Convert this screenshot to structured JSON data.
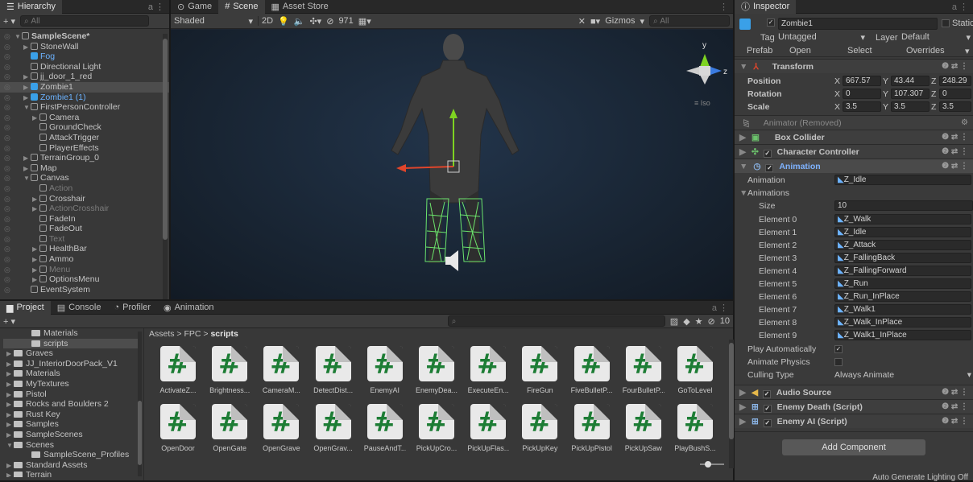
{
  "hierarchy": {
    "tab": "Hierarchy",
    "add": "+ ▾",
    "search_placeholder": "All",
    "items": [
      {
        "label": "SampleScene*",
        "indent": 0,
        "bold": true,
        "arrow": "▼",
        "cls": "scene"
      },
      {
        "label": "StoneWall",
        "indent": 1,
        "arrow": "▶"
      },
      {
        "label": "Fog",
        "indent": 1,
        "arrow": "",
        "cls": "blue",
        "cube": "blue"
      },
      {
        "label": "Directional Light",
        "indent": 1,
        "arrow": ""
      },
      {
        "label": "jj_door_1_red",
        "indent": 1,
        "arrow": "▶"
      },
      {
        "label": "Zombie1",
        "indent": 1,
        "arrow": "▶",
        "cls": "sel",
        "cube": "blue"
      },
      {
        "label": "Zombie1 (1)",
        "indent": 1,
        "arrow": "▶",
        "cls": "blue",
        "cube": "blue"
      },
      {
        "label": "FirstPersonController",
        "indent": 1,
        "arrow": "▼"
      },
      {
        "label": "Camera",
        "indent": 2,
        "arrow": "▶"
      },
      {
        "label": "GroundCheck",
        "indent": 2,
        "arrow": ""
      },
      {
        "label": "AttackTrigger",
        "indent": 2,
        "arrow": ""
      },
      {
        "label": "PlayerEffects",
        "indent": 2,
        "arrow": ""
      },
      {
        "label": "TerrainGroup_0",
        "indent": 1,
        "arrow": "▶"
      },
      {
        "label": "Map",
        "indent": 1,
        "arrow": "▶"
      },
      {
        "label": "Canvas",
        "indent": 1,
        "arrow": "▼"
      },
      {
        "label": "Action",
        "indent": 2,
        "arrow": "",
        "cls": "dim"
      },
      {
        "label": "Crosshair",
        "indent": 2,
        "arrow": "▶"
      },
      {
        "label": "ActionCrosshair",
        "indent": 2,
        "arrow": "▶",
        "cls": "dim"
      },
      {
        "label": "FadeIn",
        "indent": 2,
        "arrow": ""
      },
      {
        "label": "FadeOut",
        "indent": 2,
        "arrow": ""
      },
      {
        "label": "Text",
        "indent": 2,
        "arrow": "",
        "cls": "dim"
      },
      {
        "label": "HealthBar",
        "indent": 2,
        "arrow": "▶"
      },
      {
        "label": "Ammo",
        "indent": 2,
        "arrow": "▶"
      },
      {
        "label": "Menu",
        "indent": 2,
        "arrow": "▶",
        "cls": "dim"
      },
      {
        "label": "OptionsMenu",
        "indent": 2,
        "arrow": "▶"
      },
      {
        "label": "EventSystem",
        "indent": 1,
        "arrow": ""
      }
    ]
  },
  "scene": {
    "tabs": [
      "Game",
      "Scene",
      "Asset Store"
    ],
    "shading": "Shaded",
    "mode2d": "2D",
    "hidden_count": "971",
    "gizmos": "Gizmos",
    "search_placeholder": "All",
    "iso": "≡ Iso",
    "axis_y": "y",
    "axis_z": "z"
  },
  "bottom": {
    "tabs": [
      "Project",
      "Console",
      "Profiler",
      "Animation"
    ],
    "hidden_count": "10",
    "breadcrumb": [
      "Assets",
      "FPC",
      "scripts"
    ],
    "folders": [
      {
        "label": "Materials",
        "indent": 2
      },
      {
        "label": "scripts",
        "indent": 2,
        "sel": true
      },
      {
        "label": "Graves",
        "indent": 0,
        "arrow": "▶"
      },
      {
        "label": "JJ_InteriorDoorPack_V1",
        "indent": 0,
        "arrow": "▶"
      },
      {
        "label": "Materials",
        "indent": 0,
        "arrow": "▶"
      },
      {
        "label": "MyTextures",
        "indent": 0,
        "arrow": "▶"
      },
      {
        "label": "Pistol",
        "indent": 0,
        "arrow": "▶"
      },
      {
        "label": "Rocks and Boulders 2",
        "indent": 0,
        "arrow": "▶"
      },
      {
        "label": "Rust Key",
        "indent": 0,
        "arrow": "▶"
      },
      {
        "label": "Samples",
        "indent": 0,
        "arrow": "▶"
      },
      {
        "label": "SampleScenes",
        "indent": 0,
        "arrow": "▶"
      },
      {
        "label": "Scenes",
        "indent": 0,
        "arrow": "▼"
      },
      {
        "label": "SampleScene_Profiles",
        "indent": 2
      },
      {
        "label": "Standard Assets",
        "indent": 0,
        "arrow": "▶"
      },
      {
        "label": "Terrain",
        "indent": 0,
        "arrow": "▶"
      }
    ],
    "assets_row1": [
      "ActivateZ...",
      "Brightness...",
      "CameraM...",
      "DetectDist...",
      "EnemyAI",
      "EnemyDea...",
      "ExecuteEn...",
      "FireGun",
      "FiveBulletP...",
      "FourBulletP...",
      "GoToLevel"
    ],
    "assets_row2": [
      "OpenDoor",
      "OpenGate",
      "OpenGrave",
      "OpenGrav...",
      "PauseAndT...",
      "PickUpCro...",
      "PickUpFlas...",
      "PickUpKey",
      "PickUpPistol",
      "PickUpSaw",
      "PlayBushS..."
    ],
    "glyph": "#"
  },
  "inspector": {
    "tab": "Inspector",
    "name": "Zombie1",
    "static": "Static",
    "tag_label": "Tag",
    "tag": "Untagged",
    "layer_label": "Layer",
    "layer": "Default",
    "prefab_label": "Prefab",
    "prefab_open": "Open",
    "prefab_select": "Select",
    "prefab_overrides": "Overrides",
    "transform": {
      "title": "Transform",
      "rows": [
        {
          "label": "Position",
          "x": "667.57",
          "y": "43.44",
          "z": "248.29"
        },
        {
          "label": "Rotation",
          "x": "0",
          "y": "107.307",
          "z": "0"
        },
        {
          "label": "Scale",
          "x": "3.5",
          "y": "3.5",
          "z": "3.5"
        }
      ]
    },
    "animator_removed": "Animator (Removed)",
    "box_collider": "Box Collider",
    "char_controller": "Character Controller",
    "animation": {
      "title": "Animation",
      "anim_label": "Animation",
      "anim_value": "Z_Idle",
      "animations_label": "Animations",
      "size_label": "Size",
      "size": "10",
      "elements": [
        {
          "label": "Element 0",
          "value": "Z_Walk"
        },
        {
          "label": "Element 1",
          "value": "Z_Idle"
        },
        {
          "label": "Element 2",
          "value": "Z_Attack"
        },
        {
          "label": "Element 3",
          "value": "Z_FallingBack"
        },
        {
          "label": "Element 4",
          "value": "Z_FallingForward"
        },
        {
          "label": "Element 5",
          "value": "Z_Run"
        },
        {
          "label": "Element 6",
          "value": "Z_Run_InPlace"
        },
        {
          "label": "Element 7",
          "value": "Z_Walk1"
        },
        {
          "label": "Element 8",
          "value": "Z_Walk_InPlace"
        },
        {
          "label": "Element 9",
          "value": "Z_Walk1_InPlace"
        }
      ],
      "play_auto": "Play Automatically",
      "anim_physics": "Animate Physics",
      "culling_label": "Culling Type",
      "culling": "Always Animate"
    },
    "audio_source": "Audio Source",
    "enemy_death": "Enemy Death (Script)",
    "enemy_ai": "Enemy AI (Script)",
    "add_component": "Add Component",
    "status": "Auto Generate Lighting Off"
  },
  "colors": {
    "accent": "#3aa0e8",
    "script_green": "#1d7d35",
    "gizmo_x": "#e0452b",
    "gizmo_y": "#7ed321",
    "wire": "#6ce46c"
  }
}
